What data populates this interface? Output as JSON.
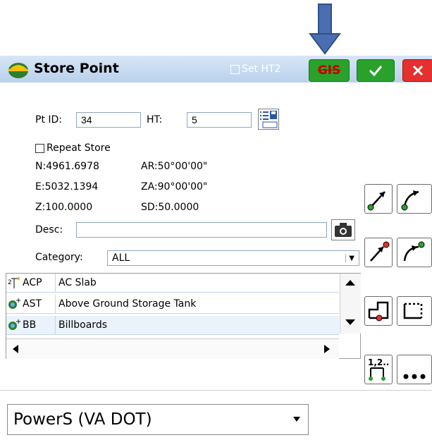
{
  "titlebar": {
    "title": "Store Point",
    "set_ht2_label": "Set HT2",
    "gis_label": "GIS"
  },
  "form": {
    "pt_id_label": "Pt ID:",
    "pt_id_value": "34",
    "ht_label": "HT:",
    "ht_value": "5",
    "repeat_store_label": "Repeat Store",
    "n_value": "N:4961.6978",
    "e_value": "E:5032.1394",
    "z_value": "Z:100.0000",
    "ar_value": "AR:50°00'00\"",
    "za_value": "ZA:90°00'00\"",
    "sd_value": "SD:50.0000",
    "desc_label": "Desc:",
    "desc_value": "",
    "category_label": "Category:",
    "category_value": "ALL"
  },
  "feature_list": [
    {
      "code": "ACP",
      "name": "AC Slab"
    },
    {
      "code": "AST",
      "name": "Above Ground Storage Tank"
    },
    {
      "code": "BB",
      "name": "Billboards"
    }
  ],
  "side_buttons_icons": [
    "survey-shot-icon",
    "offset-shot-icon",
    "point-shot-icon",
    "curve-shot-icon",
    "corner-icon",
    "rectangle-icon",
    "numbering-icon",
    "more-icon"
  ],
  "bottom_combo": {
    "value": "PowerS (VA DOT)"
  },
  "colors": {
    "titlebar": "#c4d9f0",
    "green_button": "#2aa12a",
    "red_button": "#e53030",
    "annotation_arrow": "#4a6fb0"
  }
}
